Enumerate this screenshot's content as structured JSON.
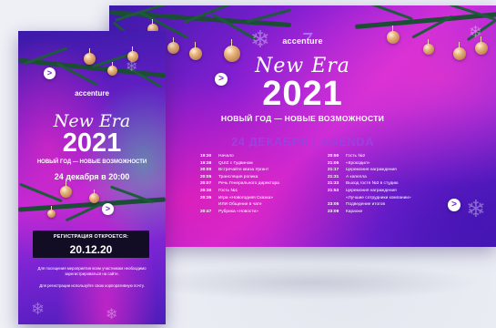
{
  "brand": "accenture",
  "wide": {
    "script_title": "New Era",
    "year": "2021",
    "subtitle": "НОВЫЙ ГОД — НОВЫЕ ВОЗМОЖНОСТИ",
    "agenda_heading": "24 ДЕКАБРЯ | AGENDA",
    "agenda_left": [
      {
        "time": "19:30",
        "text": "Начало"
      },
      {
        "time": "19:38",
        "text": "QUIZ с Гудвином"
      },
      {
        "time": "20:00",
        "text": "Встречайте квиза Ургант"
      },
      {
        "time": "20:05",
        "text": "Трансляция ролика"
      },
      {
        "time": "20:07",
        "text": "Речь Генерального директора"
      },
      {
        "time": "20:30",
        "text": "Гость №1"
      },
      {
        "time": "20:35",
        "text": "Игра «Новогодняя Сказка»"
      },
      {
        "time": "",
        "text": "ИЛИ Общение в чате"
      },
      {
        "time": "20:47",
        "text": "Рубрика «Новости»"
      }
    ],
    "agenda_right": [
      {
        "time": "20:50",
        "text": "Гость №2"
      },
      {
        "time": "21:05",
        "text": "«Крокодил»"
      },
      {
        "time": "21:17",
        "text": "Церемония награждения"
      },
      {
        "time": "21:31",
        "text": "А капелла"
      },
      {
        "time": "21:33",
        "text": "Выход гостя №3 в студию"
      },
      {
        "time": "21:53",
        "text": "Церемония награждения"
      },
      {
        "time": "",
        "text": "«Лучшие сотрудники компании»"
      },
      {
        "time": "23:05",
        "text": "Подведение итогов"
      },
      {
        "time": "23:09",
        "text": "Караоке"
      }
    ]
  },
  "tall": {
    "script_title": "New Era",
    "year": "2021",
    "subtitle": "НОВЫЙ ГОД — НОВЫЕ ВОЗМОЖНОСТИ",
    "date_line": "24 декабря в 20:00",
    "registration_label": "РЕГИСТРАЦИЯ ОТКРОЕТСЯ:",
    "registration_date": "20.12.20",
    "note_1": "Для посещения мероприятия всем участникам необходимо зарегистрироваться на сайте.",
    "note_2": "Для регистрации используйте свою корпоративную почту."
  },
  "icons": {
    "arrow": ">",
    "snowflake": "❄"
  },
  "colors": {
    "accent_purple": "#9e3fe0",
    "registration_box": "#120c24"
  }
}
